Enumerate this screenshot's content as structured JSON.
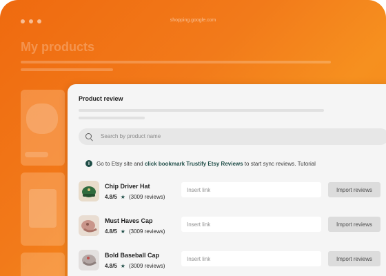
{
  "browser": {
    "url": "shopping.google.com"
  },
  "page": {
    "title": "My products"
  },
  "panel": {
    "title": "Product review",
    "search_placeholder": "Search by product name",
    "info": {
      "prefix": "Go to Etsy site and",
      "link_text": "click bookmark Trustify Etsy Reviews",
      "suffix": "to start sync reviews. Tutorial"
    },
    "products": [
      {
        "name": "Chip Driver Hat",
        "rating": "4.8/5",
        "reviews": "(3009 reviews)",
        "link_placeholder": "Insert link",
        "button": "Import reviews",
        "image_color": "#2f6b3d"
      },
      {
        "name": "Must Haves Cap",
        "rating": "4.8/5",
        "reviews": "(3009 reviews)",
        "link_placeholder": "Insert link",
        "button": "Import reviews",
        "image_color": "#c9958a"
      },
      {
        "name": "Bold Baseball Cap",
        "rating": "4.8/5",
        "reviews": "(3009 reviews)",
        "link_placeholder": "Insert link",
        "button": "Import reviews",
        "image_color": "#b4a7a5"
      }
    ]
  },
  "colors": {
    "accent": "#1f4d47",
    "brand_orange": "#f27a1a"
  }
}
